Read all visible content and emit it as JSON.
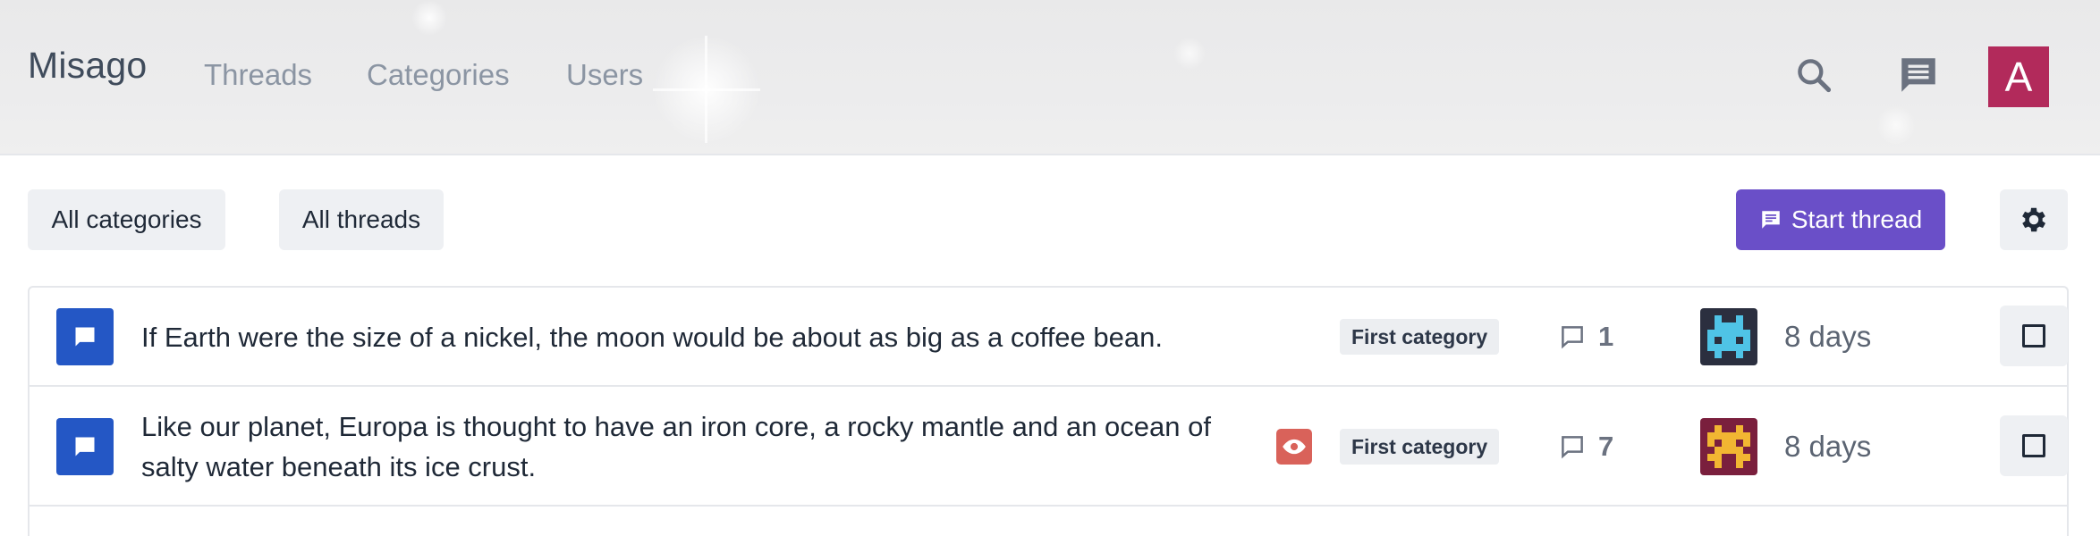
{
  "navbar": {
    "brand": "Misago",
    "links": [
      "Threads",
      "Categories",
      "Users"
    ],
    "search_icon": "search-icon",
    "messages_icon": "chat-bubble-icon",
    "user_initial": "A",
    "user_avatar_color": "#b22a5b"
  },
  "toolbar": {
    "categories_filter": "All categories",
    "threads_filter": "All threads",
    "start_thread_label": "Start thread",
    "start_thread_icon": "chat-bubble-icon",
    "settings_icon": "gear-icon",
    "accent_color": "#6a4fc8"
  },
  "threads": [
    {
      "title": "If Earth were the size of a nickel, the moon would be about as big as a coffee bean.",
      "category": "First category",
      "replies": "1",
      "last_activity": "8 days",
      "watching": false,
      "avatar_icon": "space-invader-blue-avatar"
    },
    {
      "title": "Like our planet, Europa is thought to have an iron core, a rocky mantle and an ocean of salty water beneath its ice crust.",
      "category": "First category",
      "replies": "7",
      "last_activity": "8 days",
      "watching": true,
      "avatar_icon": "space-invader-yellow-avatar"
    }
  ]
}
